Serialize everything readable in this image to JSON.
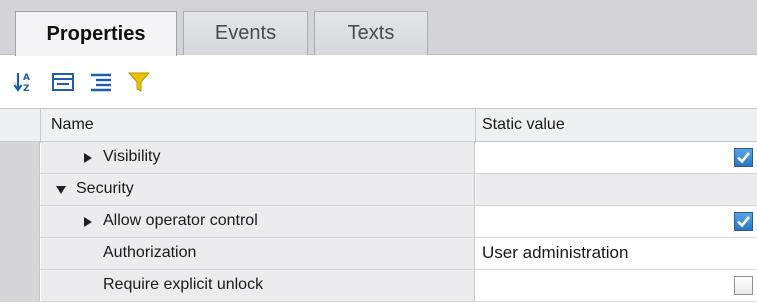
{
  "tabs": [
    {
      "label": "Properties",
      "active": true
    },
    {
      "label": "Events",
      "active": false
    },
    {
      "label": "Texts",
      "active": false
    }
  ],
  "toolbar": {
    "buttons": [
      {
        "icon": "sort-alphabetical-icon"
      },
      {
        "icon": "collapse-all-icon"
      },
      {
        "icon": "expand-all-icon"
      },
      {
        "icon": "filter-icon"
      }
    ]
  },
  "grid": {
    "columns": {
      "name": "Name",
      "value": "Static value"
    },
    "rows": [
      {
        "label": "Visibility",
        "expander": "collapsed",
        "indent": 1,
        "value_type": "checkbox",
        "checked": true
      },
      {
        "label": "Security",
        "expander": "expanded",
        "indent": 0,
        "value_type": "none"
      },
      {
        "label": "Allow operator control",
        "expander": "collapsed",
        "indent": 1,
        "value_type": "checkbox",
        "checked": true
      },
      {
        "label": "Authorization",
        "expander": "none",
        "indent": 1,
        "value_type": "text",
        "value": "User administration"
      },
      {
        "label": "Require explicit unlock",
        "expander": "none",
        "indent": 1,
        "value_type": "checkbox",
        "checked": false
      }
    ]
  },
  "colors": {
    "accent": "#2a76c4",
    "filter_yellow": "#e6c200",
    "icon_blue": "#1f5fa8"
  }
}
